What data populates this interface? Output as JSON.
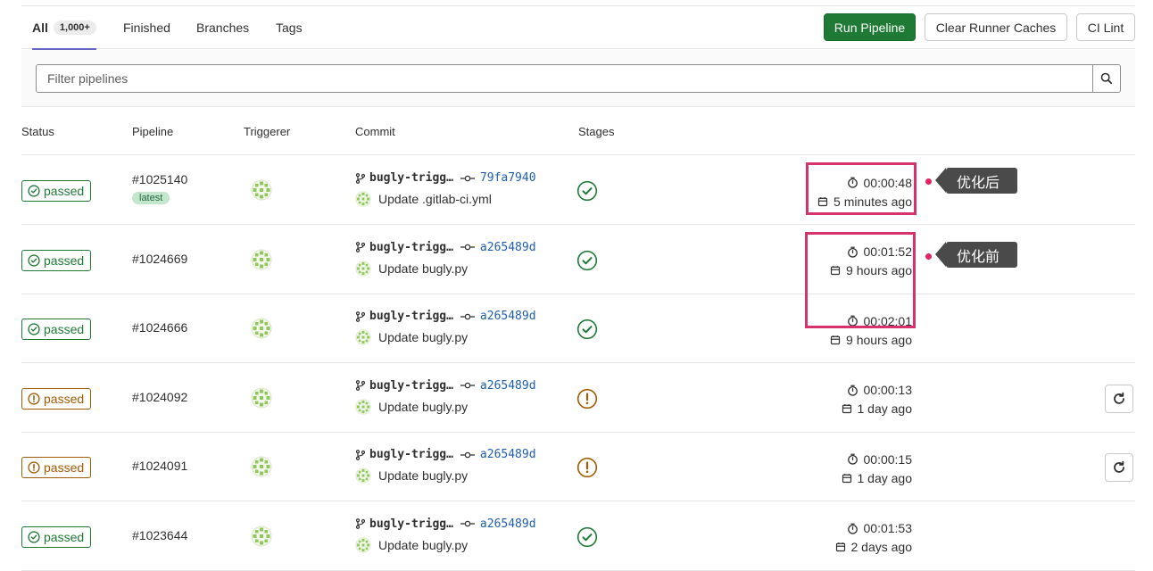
{
  "tabs": [
    {
      "label": "All",
      "count": "1,000+"
    },
    {
      "label": "Finished"
    },
    {
      "label": "Branches"
    },
    {
      "label": "Tags"
    }
  ],
  "actions": {
    "run_pipeline": "Run Pipeline",
    "clear_caches": "Clear Runner Caches",
    "ci_lint": "CI Lint"
  },
  "filter": {
    "placeholder": "Filter pipelines"
  },
  "columns": {
    "status": "Status",
    "pipeline": "Pipeline",
    "triggerer": "Triggerer",
    "commit": "Commit",
    "stages": "Stages"
  },
  "colors": {
    "success": "#1f7a35",
    "warning": "#a45a00",
    "highlight": "#d6336c",
    "sha": "#1f5fae"
  },
  "rows": [
    {
      "status": "passed",
      "status_type": "success",
      "id": "#1025140",
      "tag": "latest",
      "branch": "bugly-trigg…",
      "sha": "79fa7940",
      "message": "Update .gitlab-ci.yml",
      "stage_icon": "check-circle-icon",
      "duration": "00:00:48",
      "finished": "5 minutes ago",
      "retry": false
    },
    {
      "status": "passed",
      "status_type": "success",
      "id": "#1024669",
      "branch": "bugly-trigg…",
      "sha": "a265489d",
      "message": "Update bugly.py",
      "stage_icon": "check-circle-icon",
      "duration": "00:01:52",
      "finished": "9 hours ago",
      "retry": false
    },
    {
      "status": "passed",
      "status_type": "success",
      "id": "#1024666",
      "branch": "bugly-trigg…",
      "sha": "a265489d",
      "message": "Update bugly.py",
      "stage_icon": "check-circle-icon",
      "duration": "00:02:01",
      "finished": "9 hours ago",
      "retry": false
    },
    {
      "status": "passed",
      "status_type": "warning",
      "id": "#1024092",
      "branch": "bugly-trigg…",
      "sha": "a265489d",
      "message": "Update bugly.py",
      "stage_icon": "warning-circle-icon",
      "duration": "00:00:13",
      "finished": "1 day ago",
      "retry": true
    },
    {
      "status": "passed",
      "status_type": "warning",
      "id": "#1024091",
      "branch": "bugly-trigg…",
      "sha": "a265489d",
      "message": "Update bugly.py",
      "stage_icon": "warning-circle-icon",
      "duration": "00:00:15",
      "finished": "1 day ago",
      "retry": true
    },
    {
      "status": "passed",
      "status_type": "success",
      "id": "#1023644",
      "branch": "bugly-trigg…",
      "sha": "a265489d",
      "message": "Update bugly.py",
      "stage_icon": "check-circle-icon",
      "duration": "00:01:53",
      "finished": "2 days ago",
      "retry": false
    }
  ],
  "annotations": {
    "after": "优化后",
    "before": "优化前"
  }
}
